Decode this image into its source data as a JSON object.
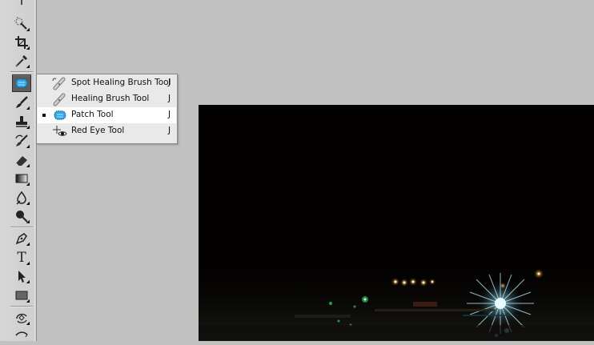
{
  "toolbar": {
    "tools": [
      {
        "name": "quick-selection-tool",
        "icon": "quick-selection-icon"
      },
      {
        "name": "crop-tool",
        "icon": "crop-icon"
      },
      {
        "name": "eyedropper-tool",
        "icon": "eyedropper-icon"
      },
      {
        "name": "patch-tool",
        "icon": "patch-icon",
        "active": true
      },
      {
        "name": "brush-tool",
        "icon": "brush-icon"
      },
      {
        "name": "clone-stamp-tool",
        "icon": "stamp-icon"
      },
      {
        "name": "history-brush-tool",
        "icon": "history-brush-icon"
      },
      {
        "name": "eraser-tool",
        "icon": "eraser-icon"
      },
      {
        "name": "gradient-tool",
        "icon": "gradient-icon"
      },
      {
        "name": "blur-tool",
        "icon": "blur-icon"
      },
      {
        "name": "dodge-tool",
        "icon": "dodge-icon"
      },
      {
        "name": "pen-tool",
        "icon": "pen-icon"
      },
      {
        "name": "type-tool",
        "icon": "type-icon",
        "glyph": "T"
      },
      {
        "name": "path-selection-tool",
        "icon": "arrow-icon"
      },
      {
        "name": "rectangle-tool",
        "icon": "rectangle-icon"
      },
      {
        "name": "3d-rotate-tool",
        "icon": "3d-rotate-icon"
      },
      {
        "name": "3d-orbit-tool",
        "icon": "3d-orbit-icon"
      }
    ]
  },
  "flyout": {
    "items": [
      {
        "label": "Spot Healing Brush Tool",
        "shortcut": "J",
        "icon": "spot-healing-brush-icon",
        "selected": false
      },
      {
        "label": "Healing Brush Tool",
        "shortcut": "J",
        "icon": "healing-brush-icon",
        "selected": false
      },
      {
        "label": "Patch Tool",
        "shortcut": "J",
        "icon": "patch-icon",
        "selected": true
      },
      {
        "label": "Red Eye Tool",
        "shortcut": "J",
        "icon": "red-eye-icon",
        "selected": false
      }
    ]
  },
  "colors": {
    "workspace": "#c1c1c1",
    "toolbar": "#d4d4d4",
    "active_tool": "#5d5d5d",
    "menu_bg": "#e9e9e9",
    "menu_selected": "#ffffff",
    "photo_bg": "#030201"
  }
}
